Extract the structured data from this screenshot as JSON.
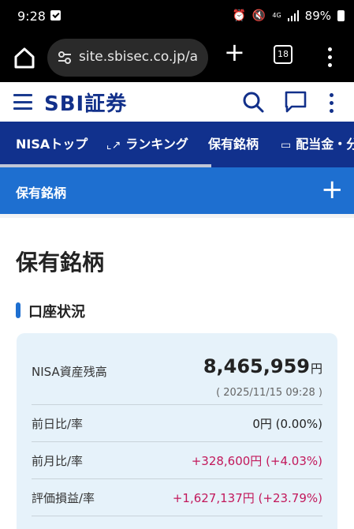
{
  "status_bar": {
    "time": "9:28",
    "network": "4G",
    "battery": "89%"
  },
  "browser": {
    "url": "site.sbisec.co.jp/a",
    "tab_count": "18"
  },
  "site_header": {
    "logo_text": "SBI証券"
  },
  "nisa_nav": {
    "tabs": [
      {
        "label": "NISAトップ"
      },
      {
        "label": "ランキング"
      },
      {
        "label": "保有銘柄"
      },
      {
        "label": "配当金・分"
      }
    ]
  },
  "section_bar": {
    "title": "保有銘柄"
  },
  "main": {
    "page_title": "保有銘柄",
    "account_section_title": "口座状況",
    "nisa_balance": {
      "label": "NISA資産残高",
      "value": "8,465,959",
      "unit": "円",
      "as_of": "( 2025/11/15 09:28 )"
    },
    "rows": [
      {
        "label": "前日比/率",
        "value": "0円 (0.00%)"
      },
      {
        "label": "前月比/率",
        "value": "+328,600円 (+4.03%)"
      },
      {
        "label": "評価損益/率",
        "value": "+1,627,137円 (+23.79%)"
      }
    ]
  },
  "colors": {
    "brand_navy": "#11318d",
    "section_blue": "#1e6fd0",
    "positive_value": "#c2185b",
    "card_bg": "#e6f2fa"
  }
}
